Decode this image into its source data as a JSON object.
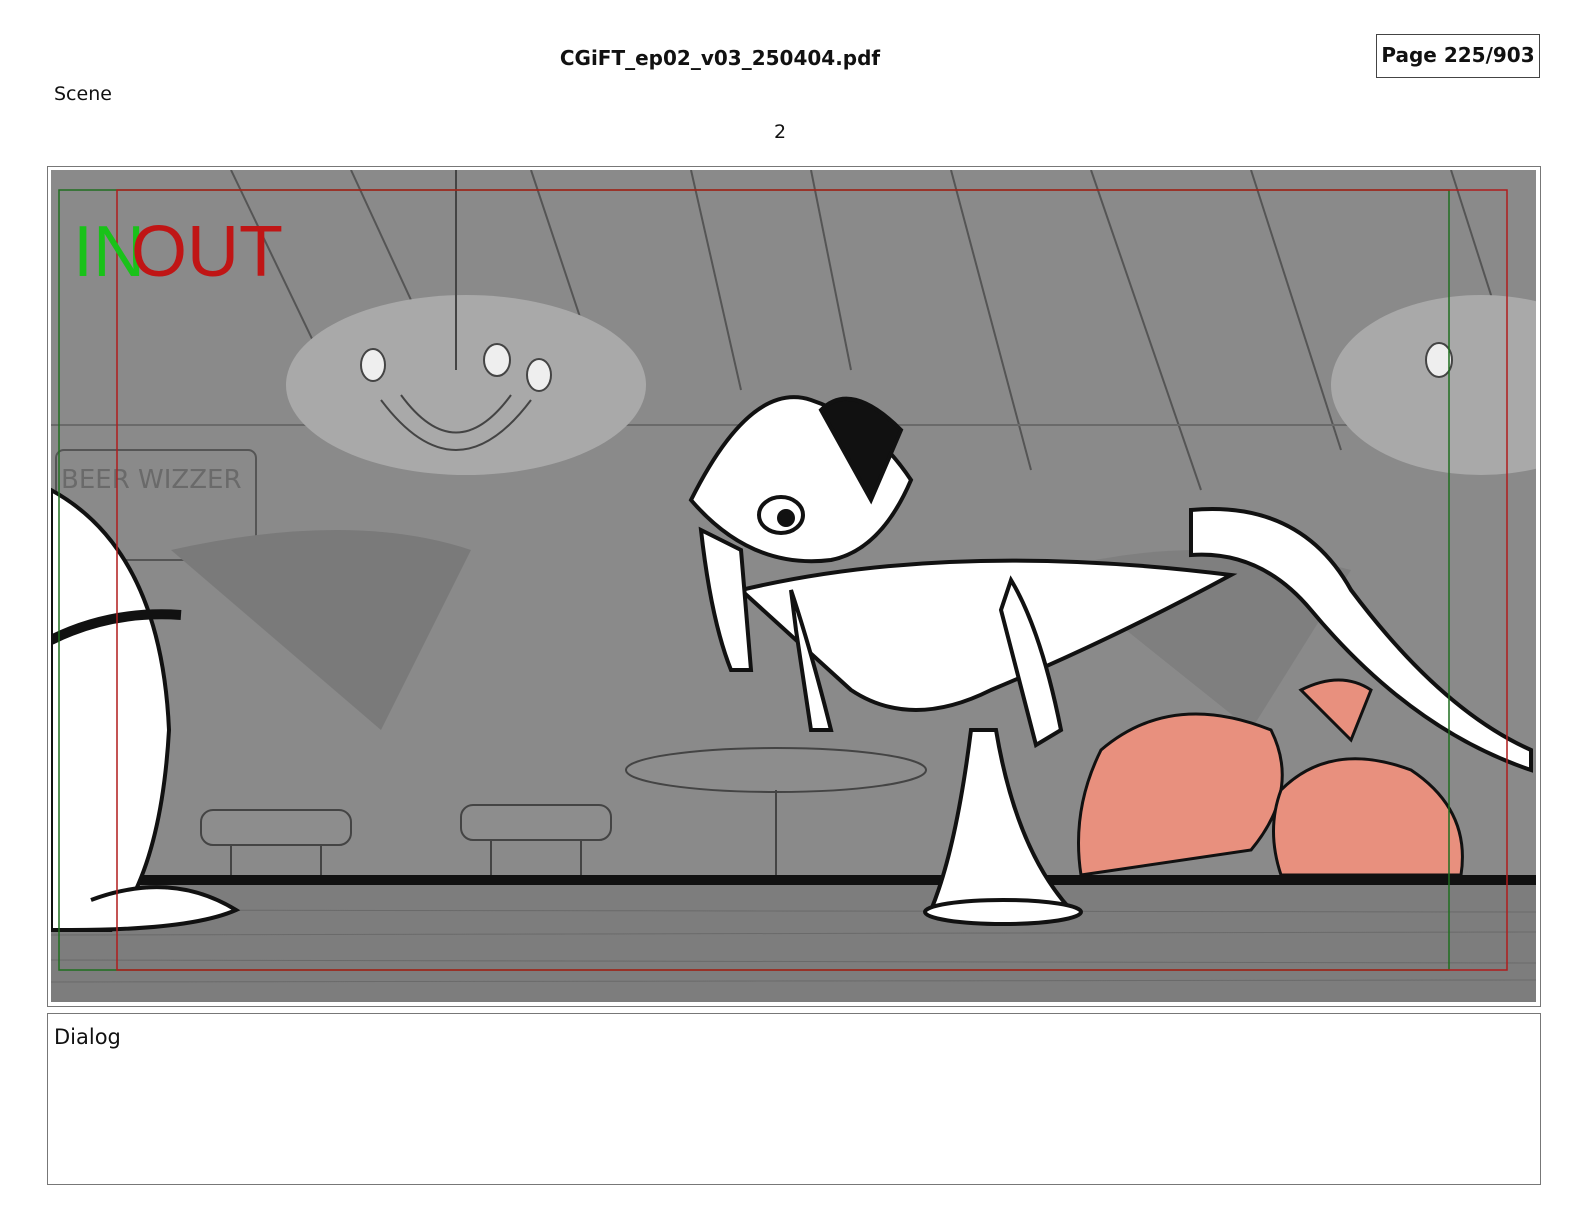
{
  "header": {
    "file_name": "CGiFT_ep02_v03_250404.pdf",
    "page_indicator": "Page 225/903"
  },
  "scene": {
    "label": "Scene",
    "number": "2"
  },
  "panel": {
    "in_marker": "IN",
    "out_marker": "OUT",
    "background_sign_text": "BEER WIZZER",
    "colors": {
      "in_marker": "#19c219",
      "out_marker": "#c01515",
      "safe_frame_in": "#1f6e1f",
      "safe_frame_out": "#b01c1c",
      "background_gray": "#8a8a8a",
      "bar_wood": "#7d7d7d",
      "character_pink": "#e8907e"
    }
  },
  "dialog": {
    "label": "Dialog",
    "text": ""
  }
}
